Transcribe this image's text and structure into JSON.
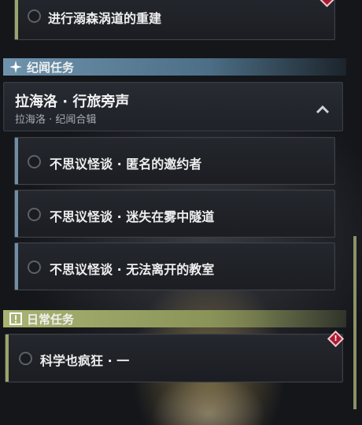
{
  "top_quest": {
    "label": "进行溺森涡道的重建"
  },
  "section_story": {
    "title": "纪闻任务",
    "icon": "sparkle-icon",
    "color": "#7fa8c0"
  },
  "chapter": {
    "title": "拉海洛 · 行旅旁声",
    "subtitle": "拉海洛 · 纪闻合辑",
    "icon": "chevron-up-icon"
  },
  "story_quests": [
    {
      "label": "不思议怪谈 · 匿名的邀约者"
    },
    {
      "label": "不思议怪谈 · 迷失在雾中隧道"
    },
    {
      "label": "不思议怪谈 · 无法离开的教室"
    }
  ],
  "section_daily": {
    "title": "日常任务",
    "icon": "exclamation-box-icon",
    "color": "#a4ae6c"
  },
  "daily_quests": [
    {
      "label": "科学也疯狂 · 一",
      "badge_icon": "alert-diamond-icon",
      "badge_text": "!"
    }
  ],
  "colors": {
    "story_bar": "#6f8fa6",
    "daily_bar": "#9aa56a",
    "alert": "#b01831"
  }
}
